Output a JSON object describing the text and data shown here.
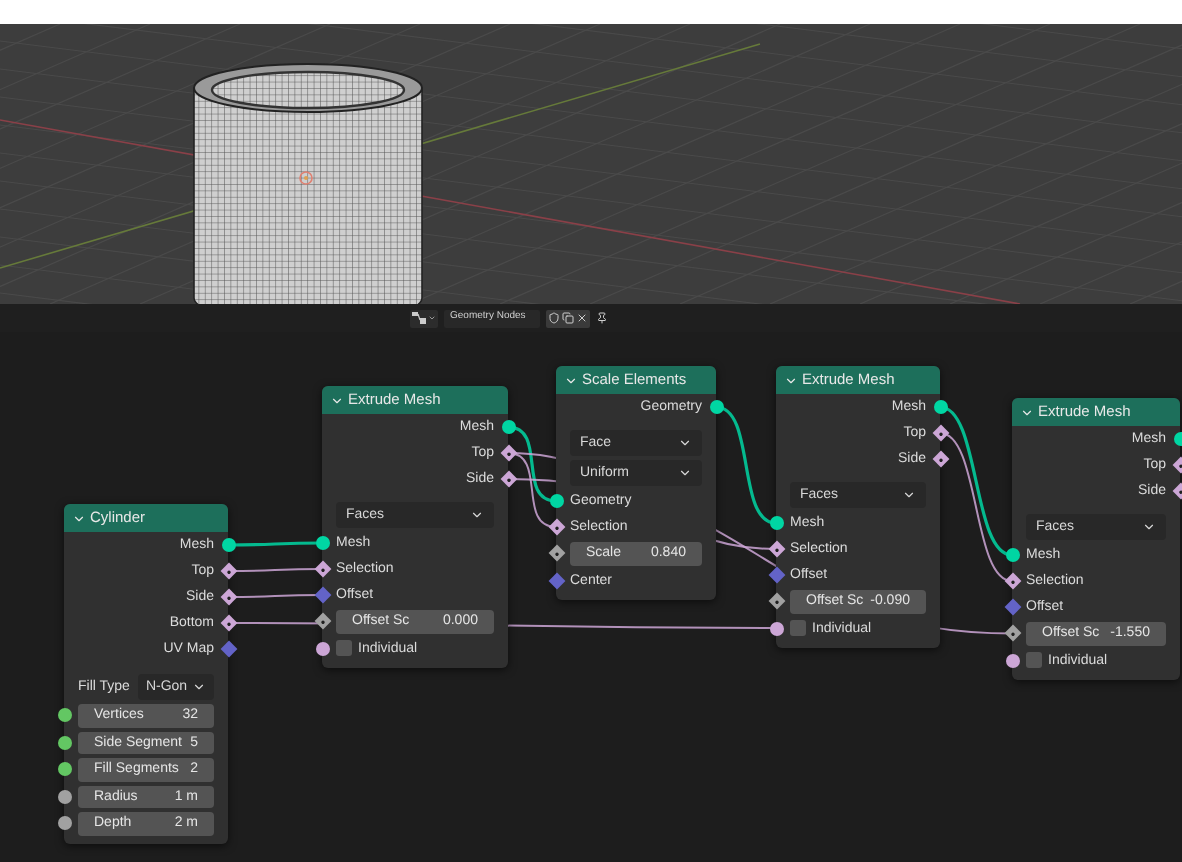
{
  "header": {
    "tree_name": "Geometry Nodes"
  },
  "nodes": [
    {
      "title": "Cylinder",
      "rows": [
        {
          "kind": "output",
          "label": "Mesh",
          "socket": {
            "color": "#00d6a3",
            "kind": "circle"
          }
        },
        {
          "kind": "output",
          "label": "Top",
          "socket": {
            "color": "#cca6d6",
            "kind": "diamond_dot"
          }
        },
        {
          "kind": "output",
          "label": "Side",
          "socket": {
            "color": "#cca6d6",
            "kind": "diamond_dot"
          }
        },
        {
          "kind": "output",
          "label": "Bottom",
          "socket": {
            "color": "#cca6d6",
            "kind": "diamond_dot"
          }
        },
        {
          "kind": "output",
          "label": "UV Map",
          "socket": {
            "color": "#6363c7",
            "kind": "diamond"
          }
        },
        {
          "kind": "select",
          "label": "Fill Type",
          "value": "N-Gon"
        },
        {
          "kind": "field",
          "label": "Vertices",
          "value": "32",
          "socket": {
            "color": "#63c763",
            "kind": "circle"
          }
        },
        {
          "kind": "field",
          "label": "Side Segment",
          "value": "5",
          "socket": {
            "color": "#63c763",
            "kind": "circle"
          }
        },
        {
          "kind": "field",
          "label": "Fill Segments",
          "value": "2",
          "socket": {
            "color": "#63c763",
            "kind": "circle"
          }
        },
        {
          "kind": "field",
          "label": "Radius",
          "value": "1 m",
          "socket": {
            "color": "#a1a1a1",
            "kind": "circle"
          }
        },
        {
          "kind": "field",
          "label": "Depth",
          "value": "2 m",
          "socket": {
            "color": "#a1a1a1",
            "kind": "circle"
          }
        }
      ]
    },
    {
      "title": "Extrude Mesh",
      "rows": [
        {
          "kind": "output",
          "label": "Mesh",
          "socket": {
            "color": "#00d6a3",
            "kind": "circle"
          }
        },
        {
          "kind": "output",
          "label": "Top",
          "socket": {
            "color": "#cca6d6",
            "kind": "diamond_dot"
          }
        },
        {
          "kind": "output",
          "label": "Side",
          "socket": {
            "color": "#cca6d6",
            "kind": "diamond_dot"
          }
        },
        {
          "kind": "dropdown",
          "value": "Faces"
        },
        {
          "kind": "input",
          "label": "Mesh",
          "socket": {
            "color": "#00d6a3",
            "kind": "circle"
          }
        },
        {
          "kind": "input",
          "label": "Selection",
          "socket": {
            "color": "#cca6d6",
            "kind": "diamond_dot"
          }
        },
        {
          "kind": "input",
          "label": "Offset",
          "socket": {
            "color": "#6363c7",
            "kind": "diamond"
          }
        },
        {
          "kind": "field",
          "label": "Offset Sc",
          "value": "0.000",
          "socket": {
            "color": "#a1a1a1",
            "kind": "diamond_dot"
          }
        },
        {
          "kind": "checkbox",
          "label": "Individual",
          "checked": false,
          "socket": {
            "color": "#cca6d6",
            "kind": "circle"
          }
        }
      ]
    },
    {
      "title": "Scale Elements",
      "rows": [
        {
          "kind": "output",
          "label": "Geometry",
          "socket": {
            "color": "#00d6a3",
            "kind": "circle"
          }
        },
        {
          "kind": "dropdown",
          "value": "Face"
        },
        {
          "kind": "dropdown",
          "value": "Uniform"
        },
        {
          "kind": "input",
          "label": "Geometry",
          "socket": {
            "color": "#00d6a3",
            "kind": "circle"
          }
        },
        {
          "kind": "input",
          "label": "Selection",
          "socket": {
            "color": "#cca6d6",
            "kind": "diamond_dot"
          }
        },
        {
          "kind": "field",
          "label": "Scale",
          "value": "0.840",
          "socket": {
            "color": "#a1a1a1",
            "kind": "diamond_dot"
          }
        },
        {
          "kind": "input",
          "label": "Center",
          "socket": {
            "color": "#6363c7",
            "kind": "diamond"
          }
        }
      ]
    },
    {
      "title": "Extrude Mesh",
      "rows": [
        {
          "kind": "output",
          "label": "Mesh",
          "socket": {
            "color": "#00d6a3",
            "kind": "circle"
          }
        },
        {
          "kind": "output",
          "label": "Top",
          "socket": {
            "color": "#cca6d6",
            "kind": "diamond_dot"
          }
        },
        {
          "kind": "output",
          "label": "Side",
          "socket": {
            "color": "#cca6d6",
            "kind": "diamond_dot"
          }
        },
        {
          "kind": "dropdown",
          "value": "Faces"
        },
        {
          "kind": "input",
          "label": "Mesh",
          "socket": {
            "color": "#00d6a3",
            "kind": "circle"
          }
        },
        {
          "kind": "input",
          "label": "Selection",
          "socket": {
            "color": "#cca6d6",
            "kind": "diamond_dot"
          }
        },
        {
          "kind": "input",
          "label": "Offset",
          "socket": {
            "color": "#6363c7",
            "kind": "diamond"
          }
        },
        {
          "kind": "field",
          "label": "Offset Sc",
          "value": "-0.090",
          "socket": {
            "color": "#a1a1a1",
            "kind": "diamond_dot"
          }
        },
        {
          "kind": "checkbox",
          "label": "Individual",
          "checked": false,
          "socket": {
            "color": "#cca6d6",
            "kind": "circle"
          }
        }
      ]
    },
    {
      "title": "Extrude Mesh",
      "rows": [
        {
          "kind": "output",
          "label": "Mesh",
          "socket": {
            "color": "#00d6a3",
            "kind": "circle"
          }
        },
        {
          "kind": "output",
          "label": "Top",
          "socket": {
            "color": "#cca6d6",
            "kind": "diamond_dot"
          }
        },
        {
          "kind": "output",
          "label": "Side",
          "socket": {
            "color": "#cca6d6",
            "kind": "diamond_dot"
          }
        },
        {
          "kind": "dropdown",
          "value": "Faces"
        },
        {
          "kind": "input",
          "label": "Mesh",
          "socket": {
            "color": "#00d6a3",
            "kind": "circle"
          }
        },
        {
          "kind": "input",
          "label": "Selection",
          "socket": {
            "color": "#cca6d6",
            "kind": "diamond_dot"
          }
        },
        {
          "kind": "input",
          "label": "Offset",
          "socket": {
            "color": "#6363c7",
            "kind": "diamond"
          }
        },
        {
          "kind": "field",
          "label": "Offset Sc",
          "value": "-1.550",
          "socket": {
            "color": "#a1a1a1",
            "kind": "diamond_dot"
          }
        },
        {
          "kind": "checkbox",
          "label": "Individual",
          "checked": false,
          "socket": {
            "color": "#cca6d6",
            "kind": "circle"
          }
        }
      ]
    }
  ]
}
